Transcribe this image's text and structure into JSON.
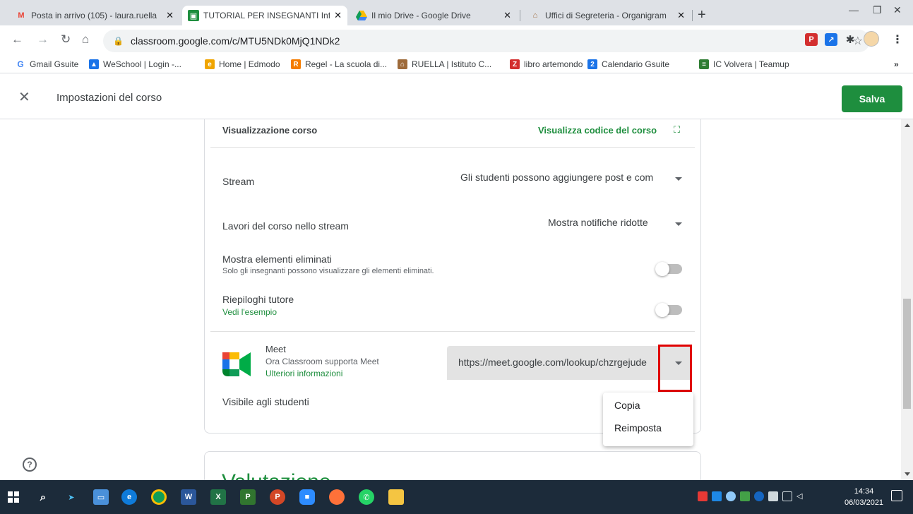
{
  "browser": {
    "tabs": [
      {
        "title": "Posta in arrivo (105) - laura.ruella",
        "favicon": "gmail-icon",
        "color": "#ea4335"
      },
      {
        "title": "TUTORIAL PER INSEGNANTI Infan",
        "favicon": "classroom-icon",
        "color": "#1e8e3e"
      },
      {
        "title": "Il mio Drive - Google Drive",
        "favicon": "drive-icon",
        "color": "#fbbc04"
      },
      {
        "title": "Uffici di Segreteria - Organigram",
        "favicon": "school-icon",
        "color": "#9e6a3a"
      }
    ],
    "url": "classroom.google.com/c/MTU5NDk0MjQ1NDk2",
    "bookmarks": [
      {
        "label": "Gmail Gsuite",
        "icon": "google-icon",
        "color": "#4285f4"
      },
      {
        "label": "WeSchool | Login -...",
        "icon": "weschool-icon",
        "color": "#1a73e8"
      },
      {
        "label": "Home | Edmodo",
        "icon": "edmodo-icon",
        "color": "#f0a500"
      },
      {
        "label": "Regel - La scuola di...",
        "icon": "regel-icon",
        "color": "#f57c00"
      },
      {
        "label": "RUELLA | Istituto C...",
        "icon": "school-icon",
        "color": "#9e6a3a"
      },
      {
        "label": "libro artemondo",
        "icon": "z-icon",
        "color": "#d32f2f"
      },
      {
        "label": "Calendario Gsuite",
        "icon": "calendar-icon",
        "color": "#1a73e8"
      },
      {
        "label": "IC Volvera | Teamup",
        "icon": "teamup-icon",
        "color": "#2e7d32"
      }
    ],
    "more": "»"
  },
  "header": {
    "title": "Impostazioni del corso",
    "save_label": "Salva"
  },
  "settings": {
    "view_label": "Visualizzazione corso",
    "view_code_link": "Visualizza codice del corso",
    "stream_label": "Stream",
    "stream_value": "Gli studenti possono aggiungere post e com",
    "classwork_label": "Lavori del corso nello stream",
    "classwork_value": "Mostra notifiche ridotte",
    "deleted_label": "Mostra elementi eliminati",
    "deleted_sub": "Solo gli insegnanti possono visualizzare gli elementi eliminati.",
    "deleted_on": false,
    "guardian_label": "Riepiloghi tutore",
    "guardian_link": "Vedi l'esempio",
    "guardian_on": false,
    "meet_label": "Meet",
    "meet_sub": "Ora Classroom supporta Meet",
    "meet_link": "Ulteriori informazioni",
    "meet_url": "https://meet.google.com/lookup/chzrgejude",
    "visible_label": "Visibile agli studenti"
  },
  "menu": {
    "items": [
      "Copia",
      "Reimposta"
    ]
  },
  "grading": {
    "title": "Valutazione"
  },
  "taskbar": {
    "time": "14:34",
    "date": "06/03/2021"
  }
}
